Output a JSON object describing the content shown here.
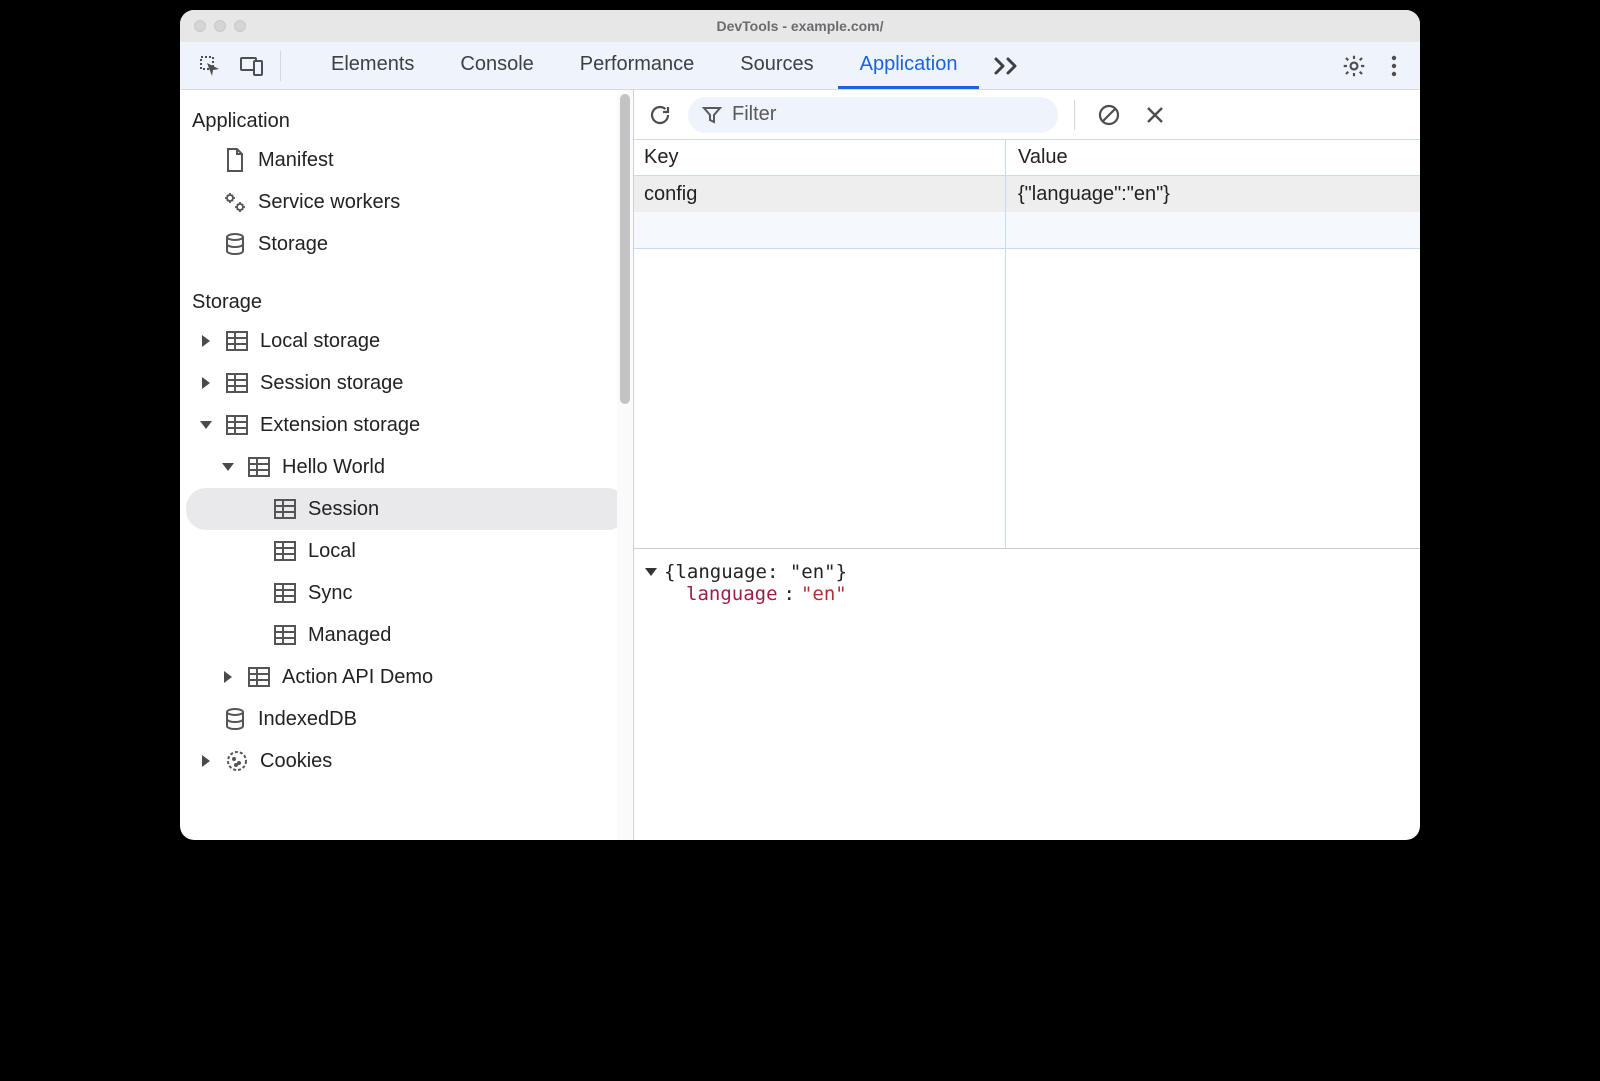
{
  "window_title": "DevTools - example.com/",
  "tabs": {
    "elements": "Elements",
    "console": "Console",
    "performance": "Performance",
    "sources": "Sources",
    "application": "Application"
  },
  "filter_placeholder": "Filter",
  "sidebar": {
    "section_application": "Application",
    "manifest": "Manifest",
    "service_workers": "Service workers",
    "storage_top": "Storage",
    "section_storage": "Storage",
    "local_storage": "Local storage",
    "session_storage": "Session storage",
    "extension_storage": "Extension storage",
    "hello_world": "Hello World",
    "session": "Session",
    "local": "Local",
    "sync": "Sync",
    "managed": "Managed",
    "action_api_demo": "Action API Demo",
    "indexeddb": "IndexedDB",
    "cookies": "Cookies"
  },
  "table": {
    "head_key": "Key",
    "head_value": "Value",
    "row_key": "config",
    "row_value": "{\"language\":\"en\"}"
  },
  "detail": {
    "summary": "{language: \"en\"}",
    "key": "language",
    "colon": ": ",
    "value": "\"en\""
  }
}
